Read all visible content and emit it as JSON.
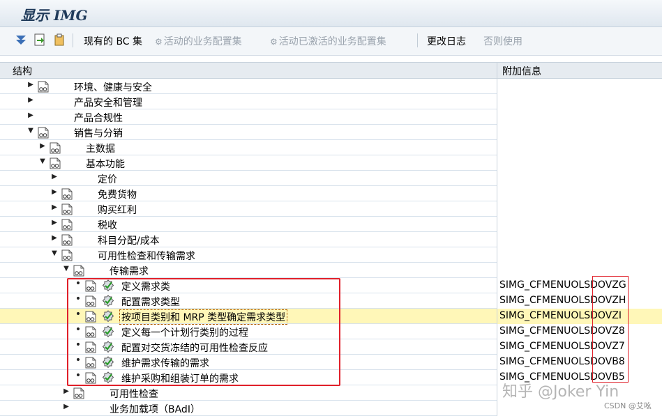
{
  "window": {
    "title": "显示 IMG"
  },
  "toolbar": {
    "existing_bc_sets": "现有的 BC 集",
    "active_bc_sets": "活动的业务配置集",
    "activated_bc_sets": "活动已激活的业务配置集",
    "change_log": "更改日志",
    "otherwise_use": "否则使用"
  },
  "columns": {
    "structure": "结构",
    "additional_info": "附加信息"
  },
  "tree": [
    {
      "label": "环境、健康与安全",
      "info": "",
      "level": 0,
      "expander": "collapsed",
      "doc": true,
      "activity": false,
      "highlighted": false
    },
    {
      "label": "产品安全和管理",
      "info": "",
      "level": 0,
      "expander": "collapsed",
      "doc": false,
      "activity": false,
      "highlighted": false
    },
    {
      "label": "产品合规性",
      "info": "",
      "level": 0,
      "expander": "collapsed",
      "doc": false,
      "activity": false,
      "highlighted": false
    },
    {
      "label": "销售与分销",
      "info": "",
      "level": 0,
      "expander": "expanded",
      "doc": true,
      "activity": false,
      "highlighted": false
    },
    {
      "label": "主数据",
      "info": "",
      "level": 1,
      "expander": "collapsed",
      "doc": true,
      "activity": false,
      "highlighted": false
    },
    {
      "label": "基本功能",
      "info": "",
      "level": 1,
      "expander": "expanded",
      "doc": true,
      "activity": false,
      "highlighted": false
    },
    {
      "label": "定价",
      "info": "",
      "level": 2,
      "expander": "collapsed",
      "doc": false,
      "activity": false,
      "highlighted": false
    },
    {
      "label": "免费货物",
      "info": "",
      "level": 2,
      "expander": "collapsed",
      "doc": true,
      "activity": false,
      "highlighted": false
    },
    {
      "label": "购买红利",
      "info": "",
      "level": 2,
      "expander": "collapsed",
      "doc": true,
      "activity": false,
      "highlighted": false
    },
    {
      "label": "税收",
      "info": "",
      "level": 2,
      "expander": "collapsed",
      "doc": true,
      "activity": false,
      "highlighted": false
    },
    {
      "label": "科目分配/成本",
      "info": "",
      "level": 2,
      "expander": "collapsed",
      "doc": true,
      "activity": false,
      "highlighted": false
    },
    {
      "label": "可用性检查和传输需求",
      "info": "",
      "level": 2,
      "expander": "expanded",
      "doc": true,
      "activity": false,
      "highlighted": false
    },
    {
      "label": "传输需求",
      "info": "",
      "level": 3,
      "expander": "expanded",
      "doc": true,
      "activity": false,
      "highlighted": false
    },
    {
      "label": "定义需求类",
      "info": "SIMG_CFMENUOLSDOVZG",
      "level": 4,
      "expander": "leaf",
      "doc": true,
      "activity": true,
      "highlighted": false
    },
    {
      "label": "配置需求类型",
      "info": "SIMG_CFMENUOLSDOVZH",
      "level": 4,
      "expander": "leaf",
      "doc": true,
      "activity": true,
      "highlighted": false
    },
    {
      "label": "按项目类别和 MRP 类型确定需求类型",
      "info": "SIMG_CFMENUOLSDOVZI",
      "level": 4,
      "expander": "leaf",
      "doc": true,
      "activity": true,
      "highlighted": true
    },
    {
      "label": "定义每一个计划行类别的过程",
      "info": "SIMG_CFMENUOLSDOVZ8",
      "level": 4,
      "expander": "leaf",
      "doc": true,
      "activity": true,
      "highlighted": false
    },
    {
      "label": "配置对交货冻结的可用性检查反应",
      "info": "SIMG_CFMENUOLSDOVZ7",
      "level": 4,
      "expander": "leaf",
      "doc": true,
      "activity": true,
      "highlighted": false
    },
    {
      "label": "维护需求传输的需求",
      "info": "SIMG_CFMENUOLSDOVB8",
      "level": 4,
      "expander": "leaf",
      "doc": true,
      "activity": true,
      "highlighted": false
    },
    {
      "label": "维护采购和组装订单的需求",
      "info": "SIMG_CFMENUOLSDOVB5",
      "level": 4,
      "expander": "leaf",
      "doc": true,
      "activity": true,
      "highlighted": false
    },
    {
      "label": "可用性检查",
      "info": "",
      "level": 3,
      "expander": "collapsed",
      "doc": true,
      "activity": false,
      "highlighted": false
    },
    {
      "label": "业务加载项（BAdI）",
      "info": "",
      "level": 3,
      "expander": "collapsed",
      "doc": false,
      "activity": false,
      "highlighted": false
    }
  ],
  "overlay": {
    "watermark": "知乎 @Joker Yin",
    "credit": "CSDN @艾吆"
  },
  "colors": {
    "highlight_row": "#fff7b8",
    "annotation_box": "#e0202a",
    "header_bg": "#e6ebf0"
  }
}
